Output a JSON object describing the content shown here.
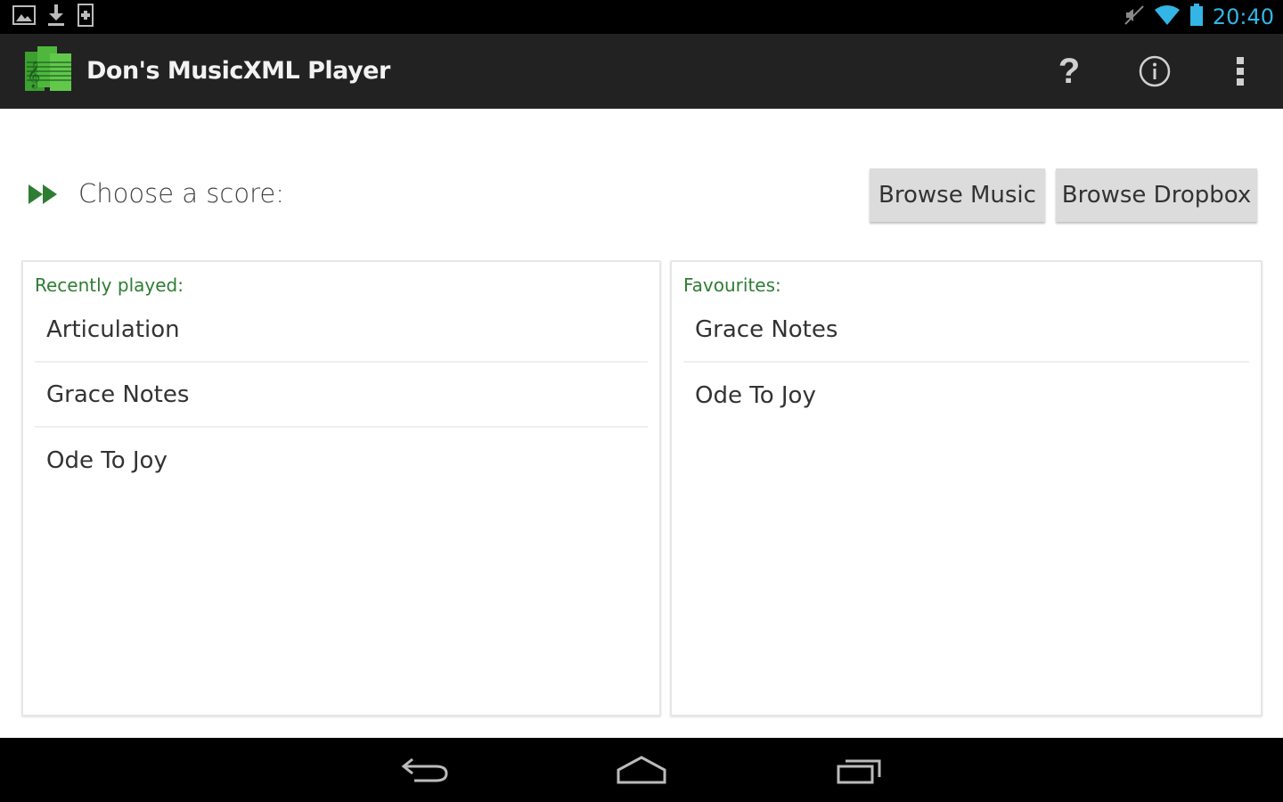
{
  "status_bar": {
    "time": "20:40",
    "left_icons": [
      "image-icon",
      "download-icon",
      "sd-card-icon"
    ],
    "right_icons": [
      "muted-icon",
      "wifi-icon",
      "battery-icon"
    ],
    "time_color": "#33b5e5"
  },
  "action_bar": {
    "title": "Don's MusicXML Player",
    "logo_icon": "music-score-logo-icon",
    "actions": {
      "help_label": "?",
      "info_icon": "info-icon",
      "overflow_icon": "overflow-menu-icon"
    }
  },
  "main": {
    "choose_label": "Choose a score:",
    "choose_icon": "fast-forward-icon",
    "browse_music_label": "Browse Music",
    "browse_dropbox_label": "Browse Dropbox",
    "accent_color": "#2e7d32"
  },
  "recent": {
    "header": "Recently played:",
    "items": [
      "Articulation",
      "Grace Notes",
      "Ode To Joy"
    ]
  },
  "favourites": {
    "header": "Favourites:",
    "items": [
      "Grace Notes",
      "Ode To Joy"
    ]
  },
  "nav_bar": {
    "icons": [
      "back-icon",
      "home-icon",
      "recent-apps-icon"
    ]
  }
}
